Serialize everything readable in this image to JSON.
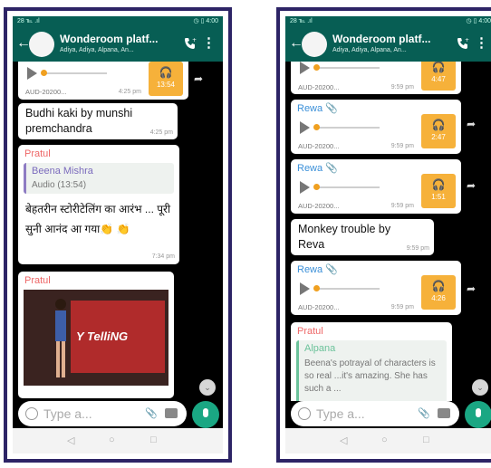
{
  "left": {
    "status_left": "28 ℡ .ıl",
    "status_right": "◷ ▯ 4:00",
    "group_title": "Wonderoom platf...",
    "group_members": "Adiya, Adiya, Alpana, An...",
    "messages": {
      "audio1": {
        "filename": "AUD-20200...",
        "time": "4:25 pm",
        "duration": "13:54"
      },
      "text1": {
        "text": "Budhi kaki by munshi premchandra",
        "time": "4:25 pm"
      },
      "reply": {
        "sender": "Pratul",
        "quote_name": "Beena Mishra",
        "quote_text": "Audio (13:54)",
        "text": "बेहतरीन स्टोरीटेलिंग का आरंभ ... पूरी सुनी आनंद आ गया👏 👏",
        "time": "7:34 pm"
      },
      "image_msg": {
        "sender": "Pratul",
        "poster_text": "Y TelliNG"
      }
    },
    "input_placeholder": "Type a..."
  },
  "right": {
    "status_left": "28 ℡ .ıl",
    "status_right": "◷ ▯ 4:00",
    "group_title": "Wonderoom platf...",
    "group_members": "Adiya, Adiya, Alpana, An...",
    "messages": {
      "audio0": {
        "filename": "AUD-20200...",
        "time": "9:59 pm",
        "duration": "4:47"
      },
      "audio1": {
        "sender": "Rewa 📎",
        "filename": "AUD-20200...",
        "time": "9:59 pm",
        "duration": "2:47"
      },
      "audio2": {
        "sender": "Rewa 📎",
        "filename": "AUD-20200...",
        "time": "9:59 pm",
        "duration": "1:51"
      },
      "text1": {
        "text": "Monkey trouble by Reva",
        "time": "9:59 pm"
      },
      "audio3": {
        "sender": "Rewa 📎",
        "filename": "AUD-20200...",
        "time": "9:59 pm",
        "duration": "4:26"
      },
      "reply": {
        "sender": "Pratul",
        "quote_name": "Alpana",
        "quote_text": "Beena's potrayal of characters is so real ...it's amazing. She has such a ..."
      }
    },
    "input_placeholder": "Type a..."
  },
  "colors": {
    "header": "#075e54",
    "accent": "#1aa783",
    "audio_badge": "#f6b13a",
    "frame": "#2d2466"
  },
  "icons": [
    "back-arrow-icon",
    "call-icon",
    "more-icon",
    "play-icon",
    "headphones-icon",
    "forward-icon",
    "emoji-icon",
    "attach-icon",
    "camera-icon",
    "mic-icon",
    "scroll-down-icon"
  ]
}
